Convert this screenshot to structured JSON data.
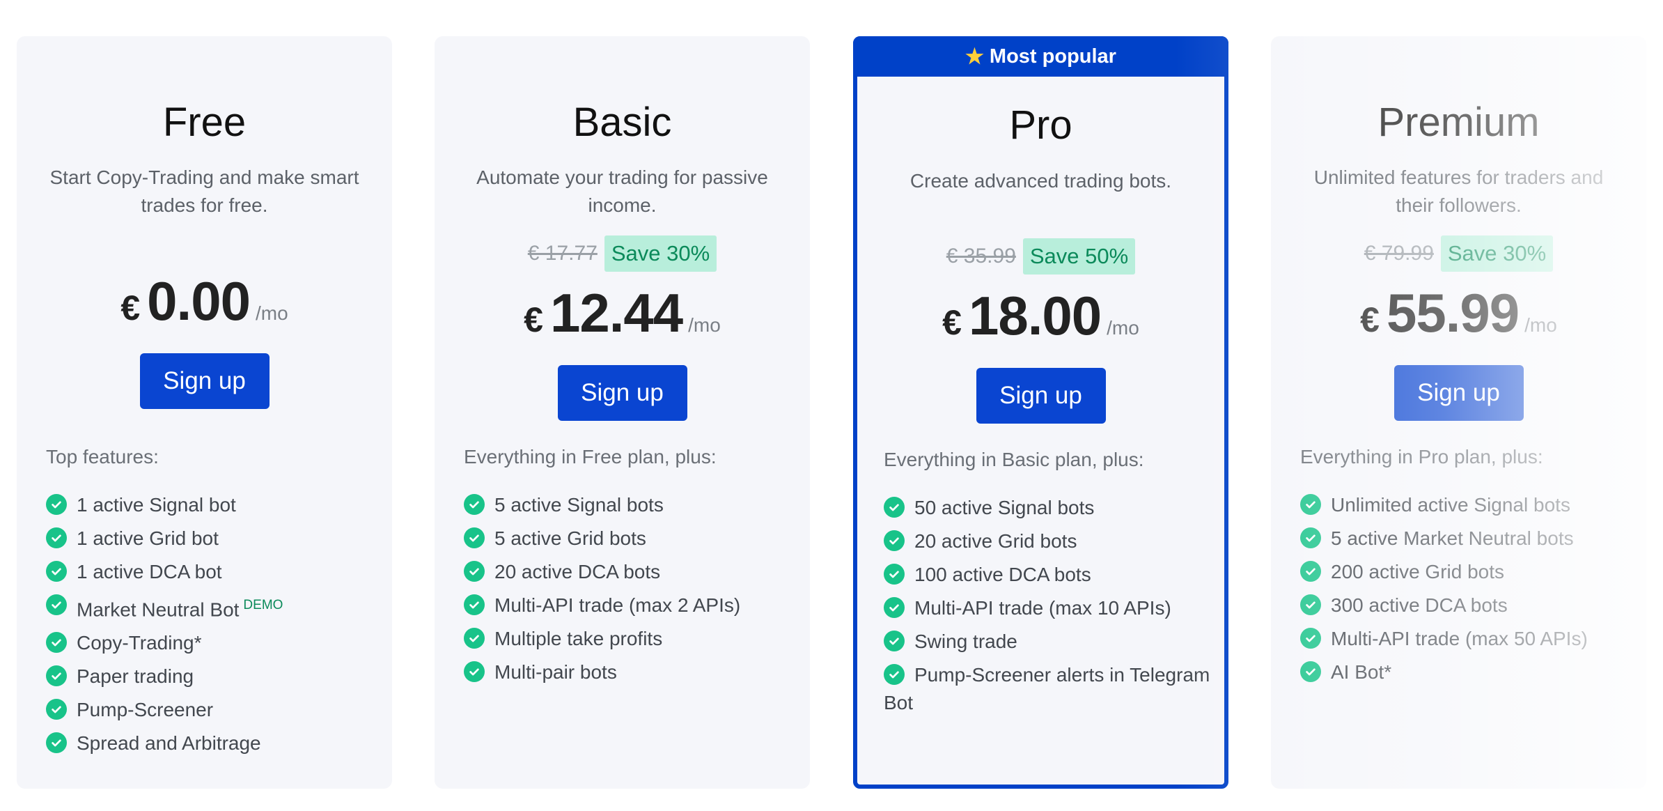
{
  "plans": [
    {
      "name": "Free",
      "description": "Start Copy-Trading and make smart trades for free.",
      "old_price": "",
      "save": "",
      "currency": "€",
      "price": "0.00",
      "period": "/mo",
      "cta": "Sign up",
      "features_title": "Top features:",
      "features": [
        "1 active Signal bot",
        "1 active Grid bot",
        "1 active DCA bot",
        "Market Neutral Bot",
        "Copy-Trading*",
        "Paper trading",
        "Pump-Screener",
        "Spread and Arbitrage"
      ],
      "demo_badge": "DEMO"
    },
    {
      "name": "Basic",
      "description": "Automate your trading for passive income.",
      "old_price": "€ 17.77",
      "save": "Save 30%",
      "currency": "€",
      "price": "12.44",
      "period": "/mo",
      "cta": "Sign up",
      "features_title": "Everything in Free plan, plus:",
      "features": [
        "5 active Signal bots",
        "5 active Grid bots",
        "20 active DCA bots",
        "Multi-API trade (max 2 APIs)",
        "Multiple take profits",
        "Multi-pair bots"
      ]
    },
    {
      "name": "Pro",
      "banner": "Most popular",
      "description": "Create advanced trading bots.",
      "old_price": "€ 35.99",
      "save": "Save 50%",
      "currency": "€",
      "price": "18.00",
      "period": "/mo",
      "cta": "Sign up",
      "features_title": "Everything in Basic plan, plus:",
      "features": [
        "50 active Signal bots",
        "20 active Grid bots",
        "100 active DCA bots",
        "Multi-API trade (max 10 APIs)",
        "Swing trade",
        "Pump-Screener alerts in Telegram Bot"
      ]
    },
    {
      "name": "Premium",
      "description": "Unlimited features for traders and their followers.",
      "old_price": "€ 79.99",
      "save": "Save 30%",
      "currency": "€",
      "price": "55.99",
      "period": "/mo",
      "cta": "Sign up",
      "features_title": "Everything in Pro plan, plus:",
      "features": [
        "Unlimited active Signal bots",
        "5 active Market Neutral bots",
        "200 active Grid bots",
        "300 active DCA bots",
        "Multi-API trade (max 50 APIs)",
        "AI Bot*"
      ]
    }
  ],
  "colors": {
    "primary": "#0a45d1",
    "check": "#18c389",
    "save_bg": "#b8eedb",
    "save_text": "#0b8a5a",
    "card_bg": "#f5f6fa"
  },
  "icons": {
    "check": "check-circle-icon",
    "star": "star-icon"
  }
}
